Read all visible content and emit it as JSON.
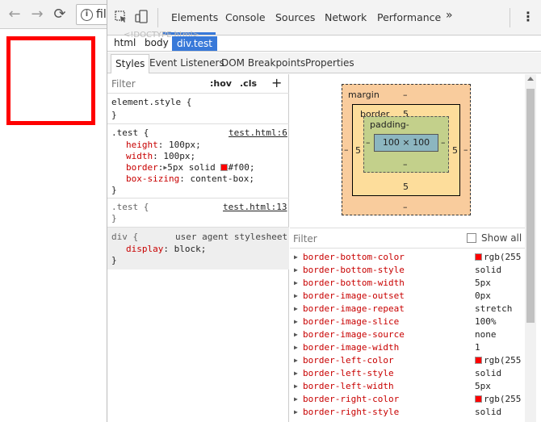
{
  "browser": {
    "back": "←",
    "forward": "→",
    "reload": "⟳",
    "url_partial": "fil"
  },
  "devtools": {
    "tabs": [
      "Elements",
      "Console",
      "Sources",
      "Network",
      "Performance"
    ],
    "more_tabs": "»",
    "menu": "⋮",
    "breadcrumb": [
      "html",
      "body"
    ],
    "breadcrumb_active": "div.test",
    "faded_doctype": "<!DOCTYPE html>",
    "subtabs": [
      "Styles",
      "Event Listeners",
      "DOM Breakpoints",
      "Properties"
    ]
  },
  "styles": {
    "filter_placeholder": "Filter",
    "hov": ":hov",
    "cls": ".cls",
    "add": "+",
    "rules": {
      "element_style": "element.style {",
      "close": "}",
      "test_selector": ".test {",
      "test_source": "test.html:6",
      "height_prop": "height",
      "height_val": "100px;",
      "width_prop": "width",
      "width_val": "100px;",
      "border_prop": "border",
      "border_val_a": "5px solid",
      "border_val_b": "#f00;",
      "boxsizing_prop": "box-sizing",
      "boxsizing_val": "content-box;",
      "test2_selector": ".test {",
      "test2_source": "test.html:13",
      "div_selector": "div {",
      "div_source": "user agent stylesheet",
      "display_prop": "display",
      "display_val": "block;"
    }
  },
  "boxmodel": {
    "margin_label": "margin",
    "margin_top": "–",
    "margin_bottom": "–",
    "margin_left": "–",
    "margin_right": "–",
    "border_label": "border",
    "border_top": "5",
    "border_bottom": "5",
    "border_left": "5",
    "border_right": "5",
    "padding_label": "padding-",
    "padding_bottom": "–",
    "padding_left": "–",
    "padding_right": "–",
    "content": "100 × 100"
  },
  "computed": {
    "filter_placeholder": "Filter",
    "show_all": "Show all",
    "rows": [
      {
        "prop": "border-bottom-color",
        "val": "rgb(255",
        "swatch": true
      },
      {
        "prop": "border-bottom-style",
        "val": "solid",
        "swatch": false
      },
      {
        "prop": "border-bottom-width",
        "val": "5px",
        "swatch": false
      },
      {
        "prop": "border-image-outset",
        "val": "0px",
        "swatch": false
      },
      {
        "prop": "border-image-repeat",
        "val": "stretch",
        "swatch": false
      },
      {
        "prop": "border-image-slice",
        "val": "100%",
        "swatch": false
      },
      {
        "prop": "border-image-source",
        "val": "none",
        "swatch": false
      },
      {
        "prop": "border-image-width",
        "val": "1",
        "swatch": false
      },
      {
        "prop": "border-left-color",
        "val": "rgb(255",
        "swatch": true
      },
      {
        "prop": "border-left-style",
        "val": "solid",
        "swatch": false
      },
      {
        "prop": "border-left-width",
        "val": "5px",
        "swatch": false
      },
      {
        "prop": "border-right-color",
        "val": "rgb(255",
        "swatch": true
      },
      {
        "prop": "border-right-style",
        "val": "solid",
        "swatch": false
      }
    ]
  },
  "colors": {
    "accent": "#3879d9",
    "test_border": "#ff0000"
  }
}
